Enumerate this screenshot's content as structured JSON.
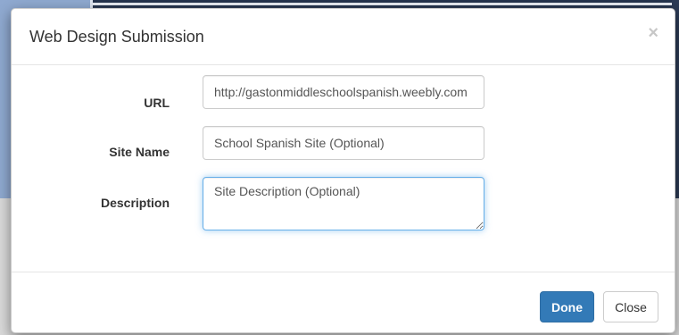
{
  "modal": {
    "title": "Web Design Submission",
    "close_icon_glyph": "×"
  },
  "form": {
    "url": {
      "label": "URL",
      "value": "http://gastonmiddleschoolspanish.weebly.com"
    },
    "site_name": {
      "label": "Site Name",
      "placeholder": "School Spanish Site (Optional)"
    },
    "description": {
      "label": "Description",
      "placeholder": "Site Description (Optional)"
    }
  },
  "footer": {
    "done_label": "Done",
    "close_label": "Close"
  },
  "colors": {
    "primary": "#337ab7",
    "focus_border": "#66afe9"
  }
}
